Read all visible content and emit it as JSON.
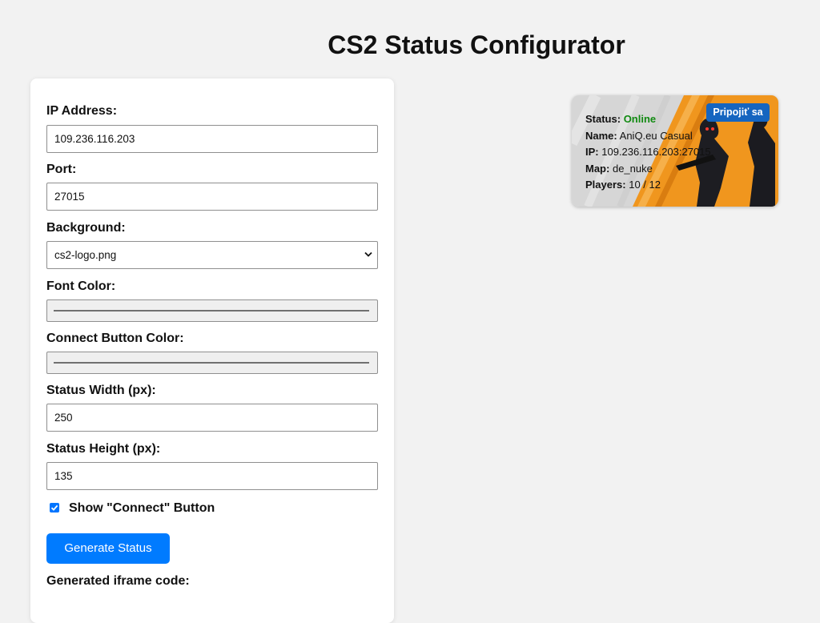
{
  "page": {
    "title": "CS2 Status Configurator"
  },
  "form": {
    "ip": {
      "label": "IP Address:",
      "value": "109.236.116.203"
    },
    "port": {
      "label": "Port:",
      "value": "27015"
    },
    "background": {
      "label": "Background:",
      "selected": "cs2-logo.png"
    },
    "font_color": {
      "label": "Font Color:"
    },
    "connect_color": {
      "label": "Connect Button Color:"
    },
    "width": {
      "label": "Status Width (px):",
      "value": "250"
    },
    "height": {
      "label": "Status Height (px):",
      "value": "135"
    },
    "show_connect": {
      "label": "Show \"Connect\" Button",
      "checked": true
    },
    "generate_label": "Generate Status",
    "iframe_label": "Generated iframe code:"
  },
  "preview": {
    "status_key": "Status:",
    "status_value": "Online",
    "name_key": "Name:",
    "name_value": "AniQ.eu Casual",
    "ip_key": "IP:",
    "ip_value": "109.236.116.203:27015",
    "map_key": "Map:",
    "map_value": "de_nuke",
    "players_key": "Players:",
    "players_value": "10 / 12",
    "connect_label": "Pripojiť sa"
  },
  "colors": {
    "accent": "#007bff",
    "connect_button": "#1565c0",
    "online": "#118a11",
    "widget_orange": "#f0961e"
  }
}
